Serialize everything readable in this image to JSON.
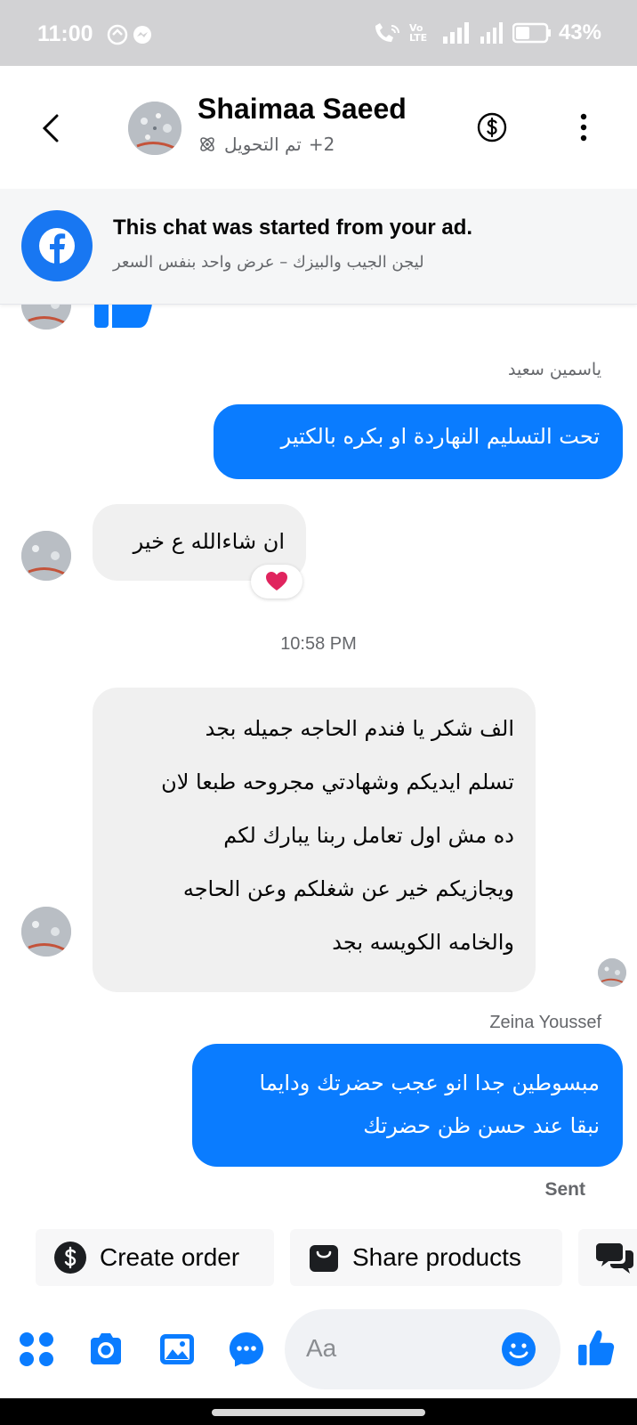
{
  "status_bar": {
    "time": "11:00",
    "network_label": "Vo LTE",
    "battery": "43%"
  },
  "header": {
    "name": "Shaimaa Saeed",
    "subtitle_count": "+2",
    "subtitle_label": "تم التحويل"
  },
  "ad_banner": {
    "title": "This chat was started from your ad.",
    "subtitle": "ليجن الجيب والبيزك – عرض واحد بنفس السعر"
  },
  "messages": {
    "sender1": "ياسمين سعيد",
    "out1": "تحت  التسليم النهاردة  او بكره بالكتير",
    "in1": "ان شاءالله ع خير",
    "timestamp": "10:58 PM",
    "in2_lines": [
      "الف شكر يا فندم الحاجه جميله بجد",
      "تسلم ايديكم وشهادتي مجروحه طبعا لان",
      "ده مش اول تعامل ربنا يبارك لكم",
      "ويجازيكم خير عن شغلكم وعن الحاجه",
      "والخامه الكويسه بجد"
    ],
    "sender2": "Zeina Youssef",
    "out2_lines": [
      "مبسوطين جدا انو عجب حضرتك ودايما",
      "نبقا عند حسن ظن حضرتك"
    ],
    "status": "Sent"
  },
  "quick_actions": {
    "create_order": "Create order",
    "share_products": "Share products"
  },
  "composer": {
    "placeholder": "Aa"
  },
  "colors": {
    "brand_blue": "#0a7cff",
    "facebook_blue": "#1877f2",
    "heart_red": "#e0245e"
  },
  "icons": [
    "back-arrow-icon",
    "dollar-circle-icon",
    "more-vertical-icon",
    "facebook-icon",
    "thumbs-up-icon",
    "heart-icon",
    "shopping-bag-icon",
    "chat-bubbles-icon",
    "apps-grid-icon",
    "camera-icon",
    "image-icon",
    "messenger-icon",
    "emoji-icon"
  ]
}
